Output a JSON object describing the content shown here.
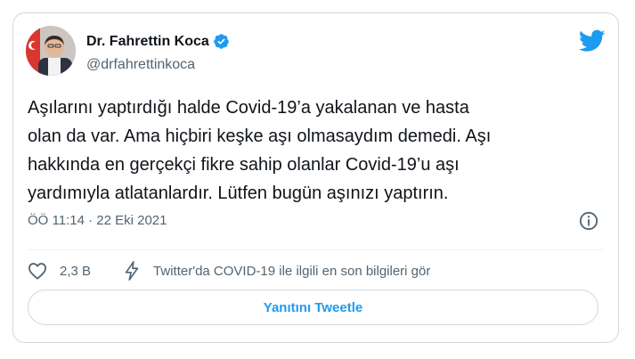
{
  "author": {
    "name": "Dr. Fahrettin Koca",
    "handle": "@drfahrettinkoca"
  },
  "tweet": {
    "text": "Aşılarını yaptırdığı halde Covid-19’a yakalanan ve hasta\nolan da var. Ama hiçbiri keşke aşı olmasaydım demedi. Aşı\nhakkında en gerçekçi fikre sahip olanlar Covid-19’u aşı\nyardımıyla atlatanlardır. Lütfen bugün aşınızı yaptırın.",
    "timestamp": "ÖÖ 11:14 · 22 Eki 2021"
  },
  "actions": {
    "like_count": "2,3 B",
    "covid_info": "Twitter'da COVID-19 ile ilgili en son bilgileri gör"
  },
  "reply_button": "Yanıtını Tweetle",
  "colors": {
    "accent": "#1d9bf0",
    "text_primary": "#0f1419",
    "text_secondary": "#536471",
    "border": "#cfd9de"
  },
  "icons": [
    "verified-icon",
    "twitter-bird-icon",
    "info-icon",
    "heart-icon",
    "lightning-icon"
  ]
}
